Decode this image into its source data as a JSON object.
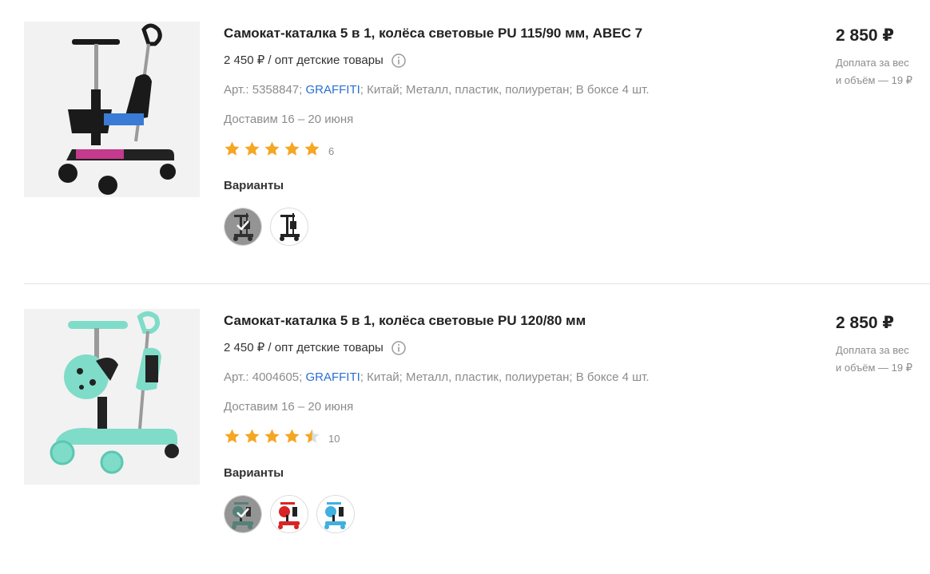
{
  "products": [
    {
      "title": "Самокат-каталка 5 в 1, колёса световые PU 115/90 мм, ABEC 7",
      "opt_price": "2 450 ₽ / опт детские товары",
      "art": "Арт.: 5358847;",
      "brand": "GRAFFITI",
      "country": "Китай;",
      "material": "Металл, пластик, полиуретан;",
      "pack": "В боксе 4 шт.",
      "delivery": "Доставим 16 – 20 июня",
      "rating": 5,
      "reviews": "6",
      "variants_label": "Варианты",
      "variants": [
        {
          "color": "#222222",
          "selected": true
        },
        {
          "color": "#222222",
          "selected": false
        }
      ],
      "price": "2 850 ₽",
      "surcharge_line1": "Доплата за вес",
      "surcharge_line2": "и объём — 19 ₽",
      "image_color": "#1a1a1a"
    },
    {
      "title": "Самокат-каталка 5 в 1, колёса световые PU 120/80 мм",
      "opt_price": "2 450 ₽ / опт детские товары",
      "art": "Арт.: 4004605;",
      "brand": "GRAFFITI",
      "country": "Китай;",
      "material": "Металл, пластик, полиуретан;",
      "pack": "В боксе 4 шт.",
      "delivery": "Доставим 16 – 20 июня",
      "rating": 4.5,
      "reviews": "10",
      "variants_label": "Варианты",
      "variants": [
        {
          "color": "#6fd6c0",
          "selected": true
        },
        {
          "color": "#d82424",
          "selected": false
        },
        {
          "color": "#3fb0e0",
          "selected": false
        }
      ],
      "price": "2 850 ₽",
      "surcharge_line1": "Доплата за вес",
      "surcharge_line2": "и объём — 19 ₽",
      "image_color": "#7fdcc8"
    }
  ],
  "colors": {
    "star": "#f5a623",
    "star_empty": "#dddddd",
    "brand_link": "#2a6fd1",
    "muted": "#8c8c8c"
  }
}
